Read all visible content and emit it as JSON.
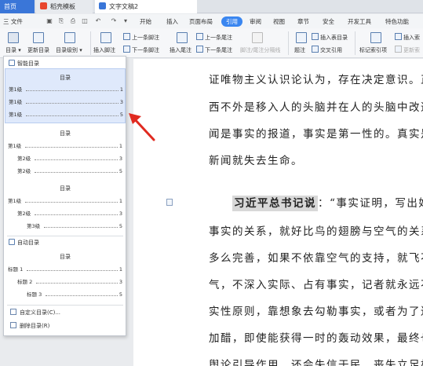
{
  "tabs": {
    "home": "首页",
    "template": "稻壳模板",
    "doc": "文字文稿2"
  },
  "menu": {
    "file": "三 文件",
    "items": [
      "开始",
      "插入",
      "页面布局",
      "引用",
      "审阅",
      "视图",
      "章节",
      "安全",
      "开发工具",
      "特色功能"
    ],
    "active_index": 3
  },
  "ribbon": {
    "toc": "目录",
    "update_toc": "更新目录",
    "toc_level": "目录级别",
    "insert_footnote": "插入脚注",
    "prev_footnote": "上一条脚注",
    "next_footnote": "下一条脚注",
    "insert_endnote": "插入尾注",
    "prev_endnote": "上一条尾注",
    "next_endnote": "下一条尾注",
    "footnote_sep": "脚注/尾注分隔线",
    "caption": "题注",
    "insert_table_toc": "插入表目录",
    "cross_ref": "交叉引用",
    "mark_index": "标记索引项",
    "insert_index": "插入索",
    "update_index": "更新索"
  },
  "document": {
    "lines": [
      "证唯物主义认识论认为，存在决定意识。正",
      "西不外是移入人的头脑并在人的头脑中改造",
      "闻是事实的报道，事实是第一性的。真实是",
      "新闻就失去生命。"
    ],
    "quote_label": "习近平总书记说",
    "quote_rest": "：“事实证明，写出好",
    "lines2": [
      "事实的关系，就好比鸟的翅膀与空气的关系",
      "多么完善，如果不依靠空气的支持，就飞不",
      "气，不深入实际、占有事实，记者就永远不",
      "实性原则，靠想象去勾勒事实，或者为了达",
      "加醋，即使能获得一时的轰动效果，最终也",
      "舆论引导作用，还会失信于民，丧失立足根"
    ]
  },
  "dropdown": {
    "smart_toc": "智能目录",
    "block1": {
      "title": "目录",
      "lines": [
        {
          "text": "第1级",
          "page": "1"
        },
        {
          "text": "第1级",
          "page": "3"
        },
        {
          "text": "第1级",
          "page": "5"
        }
      ]
    },
    "block2": {
      "title": "目录",
      "lines": [
        {
          "text": "第1级",
          "page": "1"
        },
        {
          "text": "第2级",
          "page": "3"
        },
        {
          "text": "第2级",
          "page": "5"
        }
      ]
    },
    "block3": {
      "title": "目录",
      "lines": [
        {
          "text": "第1级",
          "page": "1"
        },
        {
          "text": "第2级",
          "page": "3"
        },
        {
          "text": "第3级",
          "page": "5"
        }
      ]
    },
    "auto_toc": "自动目录",
    "block4": {
      "title": "目录",
      "lines": [
        {
          "text": "标题 1",
          "page": "1"
        },
        {
          "text": "标题 2",
          "page": "3"
        },
        {
          "text": "标题 3",
          "page": "5"
        }
      ]
    },
    "custom": "自定义目录(C)...",
    "delete": "删除目录(R)"
  }
}
